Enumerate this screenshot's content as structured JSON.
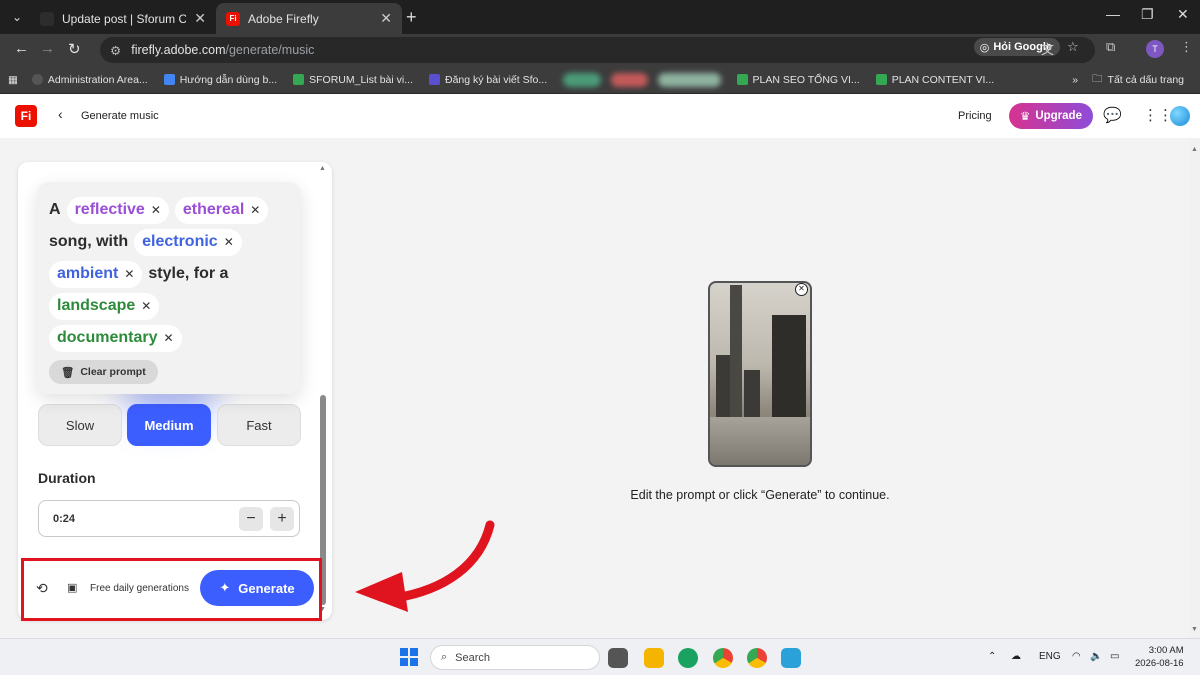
{
  "browser": {
    "tabs": [
      {
        "title": "Update post | Sforum CMS",
        "favicon_color": "#2d2d2d"
      },
      {
        "title": "Adobe Firefly",
        "favicon_color": "#eb1000",
        "favicon_text": "Fi"
      }
    ],
    "url_site": "firefly.adobe.com",
    "url_path": "/generate/music",
    "google_button": "Hỏi Google",
    "profile_initial": "T"
  },
  "bookmarks": [
    {
      "label": "Administration Area...",
      "color": "#555555"
    },
    {
      "label": "Hướng dẫn dùng b...",
      "color": "#4285f4"
    },
    {
      "label": "SFORUM_List bài vi...",
      "color": "#34a853"
    },
    {
      "label": "Đăng ký bài viết Sfo...",
      "color": "#5a4fcf"
    },
    {
      "label": "PLAN SEO TỔNG VI...",
      "color": "#34a853"
    },
    {
      "label": "PLAN CONTENT VI...",
      "color": "#34a853"
    }
  ],
  "bookmarks_more": "»",
  "bookmarks_folder": "Tất cả dấu trang",
  "header": {
    "logo": "Fi",
    "title": "Generate music",
    "pricing": "Pricing",
    "upgrade": "Upgrade"
  },
  "prompt": {
    "w1": "A",
    "chip_reflective": "reflective",
    "chip_ethereal": "ethereal",
    "w2": "song, with",
    "chip_electronic": "electronic",
    "chip_ambient": "ambient",
    "w3": "style, for a",
    "chip_landscape": "landscape",
    "chip_documentary": "documentary",
    "clear": "Clear prompt"
  },
  "speed": {
    "slow": "Slow",
    "medium": "Medium",
    "fast": "Fast",
    "selected": "Medium"
  },
  "duration": {
    "label": "Duration",
    "value": "0:24",
    "minus": "−",
    "plus": "+"
  },
  "footer": {
    "free_text": "Free daily generations",
    "generate": "Generate"
  },
  "preview": {
    "hint": "Edit the prompt or click “Generate” to continue."
  },
  "taskbar": {
    "search": "Search",
    "lang": "ENG",
    "time": "3:00 AM",
    "date": "2026-08-16"
  },
  "colors": {
    "accent": "#3d5eff",
    "highlight_box": "#e0141e",
    "brand": "#eb1000"
  }
}
